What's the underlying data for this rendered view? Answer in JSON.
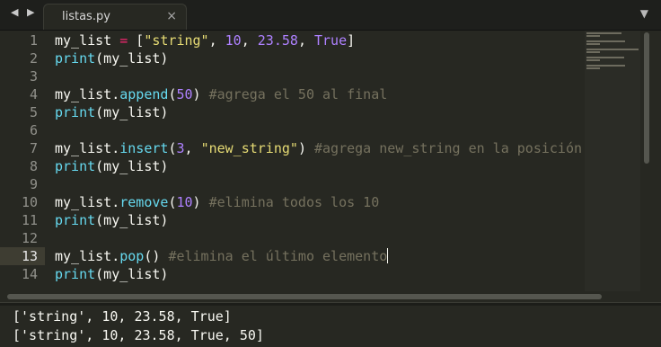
{
  "tabbar": {
    "back_icon": "◀",
    "forward_icon": "▶",
    "tab_label": "listas.py",
    "close_icon": "×",
    "menu_icon": "▼"
  },
  "editor": {
    "line_numbers": [
      "1",
      "2",
      "3",
      "4",
      "5",
      "6",
      "7",
      "8",
      "9",
      "10",
      "11",
      "12",
      "13",
      "14"
    ],
    "active_line": 13,
    "colors": {
      "background": "#272822",
      "keyword": "#f92672",
      "string": "#e6db74",
      "number": "#ae81ff",
      "function": "#66d9ef",
      "comment": "#75715e"
    },
    "lines": [
      [
        [
          "t",
          "my_list "
        ],
        [
          "k",
          "="
        ],
        [
          "t",
          " ["
        ],
        [
          "s",
          "\"string\""
        ],
        [
          "t",
          ", "
        ],
        [
          "n",
          "10"
        ],
        [
          "t",
          ", "
        ],
        [
          "n",
          "23.58"
        ],
        [
          "t",
          ", "
        ],
        [
          "n",
          "True"
        ],
        [
          "t",
          "]"
        ]
      ],
      [
        [
          "f",
          "print"
        ],
        [
          "t",
          "(my_list)"
        ]
      ],
      [],
      [
        [
          "t",
          "my_list."
        ],
        [
          "f",
          "append"
        ],
        [
          "t",
          "("
        ],
        [
          "n",
          "50"
        ],
        [
          "t",
          ") "
        ],
        [
          "c",
          "#agrega el 50 al final"
        ]
      ],
      [
        [
          "f",
          "print"
        ],
        [
          "t",
          "(my_list)"
        ]
      ],
      [],
      [
        [
          "t",
          "my_list."
        ],
        [
          "f",
          "insert"
        ],
        [
          "t",
          "("
        ],
        [
          "n",
          "3"
        ],
        [
          "t",
          ", "
        ],
        [
          "s",
          "\"new_string\""
        ],
        [
          "t",
          ") "
        ],
        [
          "c",
          "#agrega new_string en la posición"
        ]
      ],
      [
        [
          "f",
          "print"
        ],
        [
          "t",
          "(my_list)"
        ]
      ],
      [],
      [
        [
          "t",
          "my_list."
        ],
        [
          "f",
          "remove"
        ],
        [
          "t",
          "("
        ],
        [
          "n",
          "10"
        ],
        [
          "t",
          ") "
        ],
        [
          "c",
          "#elimina todos los 10"
        ]
      ],
      [
        [
          "f",
          "print"
        ],
        [
          "t",
          "(my_list)"
        ]
      ],
      [],
      [
        [
          "t",
          "my_list."
        ],
        [
          "f",
          "pop"
        ],
        [
          "t",
          "() "
        ],
        [
          "c",
          "#elimina el último elemento"
        ]
      ],
      [
        [
          "f",
          "print"
        ],
        [
          "t",
          "(my_list)"
        ]
      ]
    ]
  },
  "console": {
    "lines": [
      "['string', 10, 23.58, True]",
      "['string', 10, 23.58, True, 50]"
    ]
  }
}
